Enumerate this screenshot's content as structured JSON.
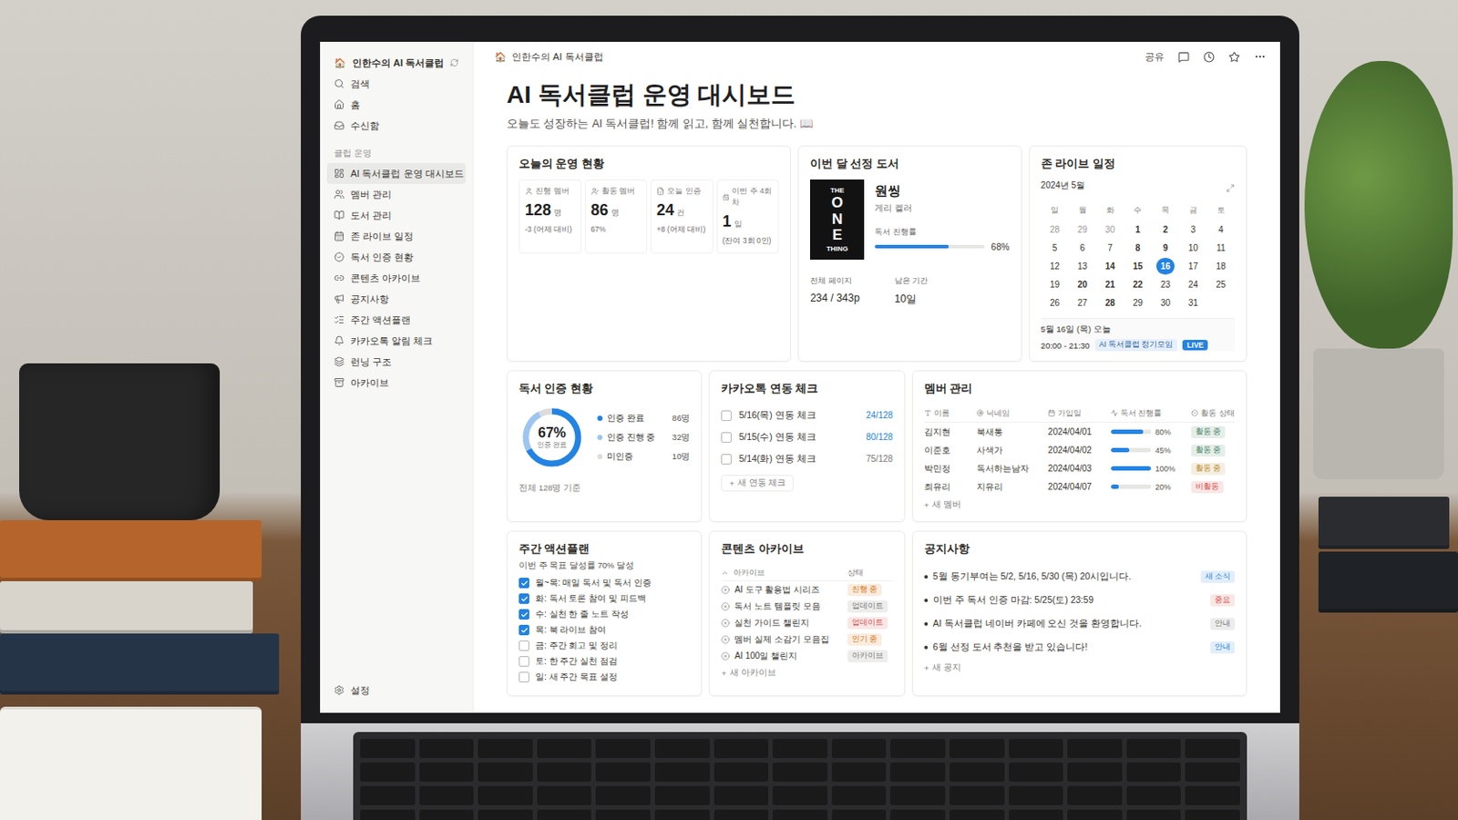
{
  "sidebar": {
    "workspace": {
      "icon": "🏠",
      "name": "인한수의 AI 독서클럽"
    },
    "nav": [
      {
        "label": "검색"
      },
      {
        "label": "홈"
      },
      {
        "label": "수신함"
      }
    ],
    "section": "클럽 운영",
    "items": [
      {
        "label": "AI 독서클럽 운영 대시보드",
        "selected": true
      },
      {
        "label": "멤버 관리",
        "selected": false
      },
      {
        "label": "도서 관리",
        "selected": false
      },
      {
        "label": "존 라이브 일정",
        "selected": false
      },
      {
        "label": "독서 인증 현황",
        "selected": false
      },
      {
        "label": "콘텐츠 아카이브",
        "selected": false
      },
      {
        "label": "공지사항",
        "selected": false
      },
      {
        "label": "주간 액션플랜",
        "selected": false
      },
      {
        "label": "카카오톡 알림 체크",
        "selected": false
      },
      {
        "label": "런닝 구조",
        "selected": false
      },
      {
        "label": "아카이브",
        "selected": false
      }
    ],
    "footer": "설정"
  },
  "topbar": {
    "breadcrumb": {
      "icon": "🏠",
      "label": "인한수의 AI 독서클럽"
    },
    "share": "공유"
  },
  "page": {
    "title": "AI 독서클럽 운영 대시보드",
    "subtitle": "오늘도 성장하는 AI 독서클럽! 함께 읽고, 함께 실천합니다. 📖"
  },
  "operations": {
    "title": "오늘의 운영 현황",
    "stats": [
      {
        "label": "진행 멤버",
        "value": "128",
        "unit": "명",
        "note": "-3 (어제 대비)"
      },
      {
        "label": "활동 멤버",
        "value": "86",
        "unit": "명",
        "note": "67%"
      },
      {
        "label": "오늘 인증",
        "value": "24",
        "unit": "건",
        "note": "+8 (어제 대비)"
      },
      {
        "label": "이번 주 4회차",
        "value": "1",
        "unit": "일",
        "note": "(잔여 3회 0인)"
      }
    ]
  },
  "book": {
    "title": "이번 달 선정 도서",
    "cover": {
      "top": "THE",
      "main": "ONE",
      "bottom": "THING"
    },
    "name": "원씽",
    "author": "게리 켈러",
    "progress": {
      "label": "독서 진행률",
      "level": 0.68,
      "reading": "68%"
    },
    "facts": [
      {
        "label": "전체 페이지",
        "value": "234 / 343p"
      },
      {
        "label": "남은 기간",
        "value": "10일"
      }
    ]
  },
  "calendar": {
    "title": "존 라이브 일정",
    "month": "2024년 5월",
    "weekdays": [
      "일",
      "월",
      "화",
      "수",
      "목",
      "금",
      "토"
    ],
    "days": [
      {
        "day": "28",
        "muted": true,
        "event": false,
        "selected": false
      },
      {
        "day": "29",
        "muted": true,
        "event": false,
        "selected": false
      },
      {
        "day": "30",
        "muted": true,
        "event": false,
        "selected": false
      },
      {
        "day": "1",
        "muted": false,
        "event": true,
        "selected": false
      },
      {
        "day": "2",
        "muted": false,
        "event": true,
        "selected": false
      },
      {
        "day": "3",
        "muted": false,
        "event": false,
        "selected": false
      },
      {
        "day": "4",
        "muted": false,
        "event": false,
        "selected": false
      },
      {
        "day": "5",
        "muted": false,
        "event": false,
        "selected": false
      },
      {
        "day": "6",
        "muted": false,
        "event": false,
        "selected": false
      },
      {
        "day": "7",
        "muted": false,
        "event": false,
        "selected": false
      },
      {
        "day": "8",
        "muted": false,
        "event": true,
        "selected": false
      },
      {
        "day": "9",
        "muted": false,
        "event": true,
        "selected": false
      },
      {
        "day": "10",
        "muted": false,
        "event": false,
        "selected": false
      },
      {
        "day": "11",
        "muted": false,
        "event": false,
        "selected": false
      },
      {
        "day": "12",
        "muted": false,
        "event": false,
        "selected": false
      },
      {
        "day": "13",
        "muted": false,
        "event": false,
        "selected": false
      },
      {
        "day": "14",
        "muted": false,
        "event": true,
        "selected": false
      },
      {
        "day": "15",
        "muted": false,
        "event": true,
        "selected": false
      },
      {
        "day": "16",
        "muted": false,
        "event": true,
        "selected": true
      },
      {
        "day": "17",
        "muted": false,
        "event": false,
        "selected": false
      },
      {
        "day": "18",
        "muted": false,
        "event": false,
        "selected": false
      },
      {
        "day": "19",
        "muted": false,
        "event": false,
        "selected": false
      },
      {
        "day": "20",
        "muted": false,
        "event": true,
        "selected": false
      },
      {
        "day": "21",
        "muted": false,
        "event": true,
        "selected": false
      },
      {
        "day": "22",
        "muted": false,
        "event": true,
        "selected": false
      },
      {
        "day": "23",
        "muted": false,
        "event": false,
        "selected": false
      },
      {
        "day": "24",
        "muted": false,
        "event": false,
        "selected": false
      },
      {
        "day": "25",
        "muted": false,
        "event": false,
        "selected": false
      },
      {
        "day": "26",
        "muted": false,
        "event": false,
        "selected": false
      },
      {
        "day": "27",
        "muted": false,
        "event": false,
        "selected": false
      },
      {
        "day": "28",
        "muted": false,
        "event": true,
        "selected": false
      },
      {
        "day": "29",
        "muted": false,
        "event": false,
        "selected": false
      },
      {
        "day": "30",
        "muted": false,
        "event": false,
        "selected": false
      },
      {
        "day": "31",
        "muted": false,
        "event": false,
        "selected": false
      }
    ],
    "today": {
      "date": "5월 16일 (목) 오늘",
      "time": "20:00 - 21:30",
      "event": "AI 독서클럽 정기모임",
      "badge": "LIVE"
    }
  },
  "certification": {
    "title": "독서 인증 현황",
    "center": "67%",
    "center_label": "인증 완료",
    "legend": [
      {
        "label": "인증 완료",
        "count": "86명",
        "value": 86,
        "color": "#2383e2"
      },
      {
        "label": "인증 진행 중",
        "count": "32명",
        "value": 32,
        "color": "#9cc6ef"
      },
      {
        "label": "미인증",
        "count": "10명",
        "value": 10,
        "color": "#dcdcdc"
      }
    ],
    "footer": "전체 128명 기준"
  },
  "kakao": {
    "title": "카카오톡 연동 체크",
    "rows": [
      {
        "label": "5/16(목) 연동 체크",
        "count": "24/128",
        "checked": false,
        "color": "#2383e2"
      },
      {
        "label": "5/15(수) 연동 체크",
        "count": "80/128",
        "checked": false,
        "color": "#2383e2"
      },
      {
        "label": "5/14(화) 연동 체크",
        "count": "75/128",
        "checked": false,
        "color": "#787774"
      }
    ],
    "add": {
      "icon": "+",
      "label": "새 연동 체크"
    }
  },
  "members": {
    "title": "멤버 관리",
    "columns": [
      "이름",
      "닉네임",
      "가입일",
      "독서 진행률",
      "활동 상태"
    ],
    "rows": [
      {
        "name": "김지현",
        "nickname": "북새통",
        "joined": "2024/04/01",
        "level": 0.8,
        "reading": "80%",
        "status": "활동 중",
        "color": "#448361"
      },
      {
        "name": "이준호",
        "nickname": "사색가",
        "joined": "2024/04/02",
        "level": 0.45,
        "reading": "45%",
        "status": "활동 중",
        "color": "#448361"
      },
      {
        "name": "박민정",
        "nickname": "독서하는남자",
        "joined": "2024/04/03",
        "level": 1.0,
        "reading": "100%",
        "status": "활동 중",
        "color": "#b7861f"
      },
      {
        "name": "최유리",
        "nickname": "지유리",
        "joined": "2024/04/07",
        "level": 0.2,
        "reading": "20%",
        "status": "비활동",
        "color": "#d44c47"
      }
    ],
    "add": {
      "icon": "+",
      "label": "새 멤버"
    }
  },
  "action_plan": {
    "title": "주간 액션플랜",
    "subtitle": "이번 주 목표 달성률 70% 달성",
    "items": [
      {
        "label": "월~목: 매일 독서 및 독서 인증",
        "checked": true
      },
      {
        "label": "화: 독서 토론 참여 및 피드백",
        "checked": true
      },
      {
        "label": "수: 실천 한 줄 노트 작성",
        "checked": true
      },
      {
        "label": "목: 북 라이브 참여",
        "checked": true
      },
      {
        "label": "금: 주간 회고 및 정리",
        "checked": false
      },
      {
        "label": "토: 한 주간 실천 점검",
        "checked": false
      },
      {
        "label": "일: 새 주간 목표 설정",
        "checked": false
      }
    ]
  },
  "archive": {
    "title": "콘텐츠 아카이브",
    "header": {
      "name": "아카이브",
      "status": "상태"
    },
    "rows": [
      {
        "name": "AI 도구 활용법 시리즈",
        "status": "진행 중",
        "color": "#d9730d"
      },
      {
        "name": "독서 노트 템플릿 모음",
        "status": "업데이트",
        "color": "#787774"
      },
      {
        "name": "실천 가이드 챌린지",
        "status": "업데이트",
        "color": "#d44c47"
      },
      {
        "name": "멤버 실제 소감기 모음집",
        "status": "인기 중",
        "color": "#d9730d"
      },
      {
        "name": "AI 100일 챌린지",
        "status": "아카이브",
        "color": "#787774"
      }
    ],
    "add": {
      "icon": "+",
      "label": "새 아카이브"
    }
  },
  "notices": {
    "title": "공지사항",
    "items": [
      {
        "text": "5월 동기부여는 5/2, 5/16, 5/30 (목) 20시입니다.",
        "tag": "새 소식",
        "color": "#2383e2"
      },
      {
        "text": "이번 주 독서 인증 마감: 5/25(토) 23:59",
        "tag": "중요",
        "color": "#d44c47"
      },
      {
        "text": "AI 독서클럽 네이버 카페에 오신 것을 환영합니다.",
        "tag": "안내",
        "color": "#787774"
      },
      {
        "text": "6월 선정 도서 추천을 받고 있습니다!",
        "tag": "안내",
        "color": "#2383e2"
      }
    ],
    "add": {
      "icon": "+",
      "label": "새 공지"
    }
  }
}
